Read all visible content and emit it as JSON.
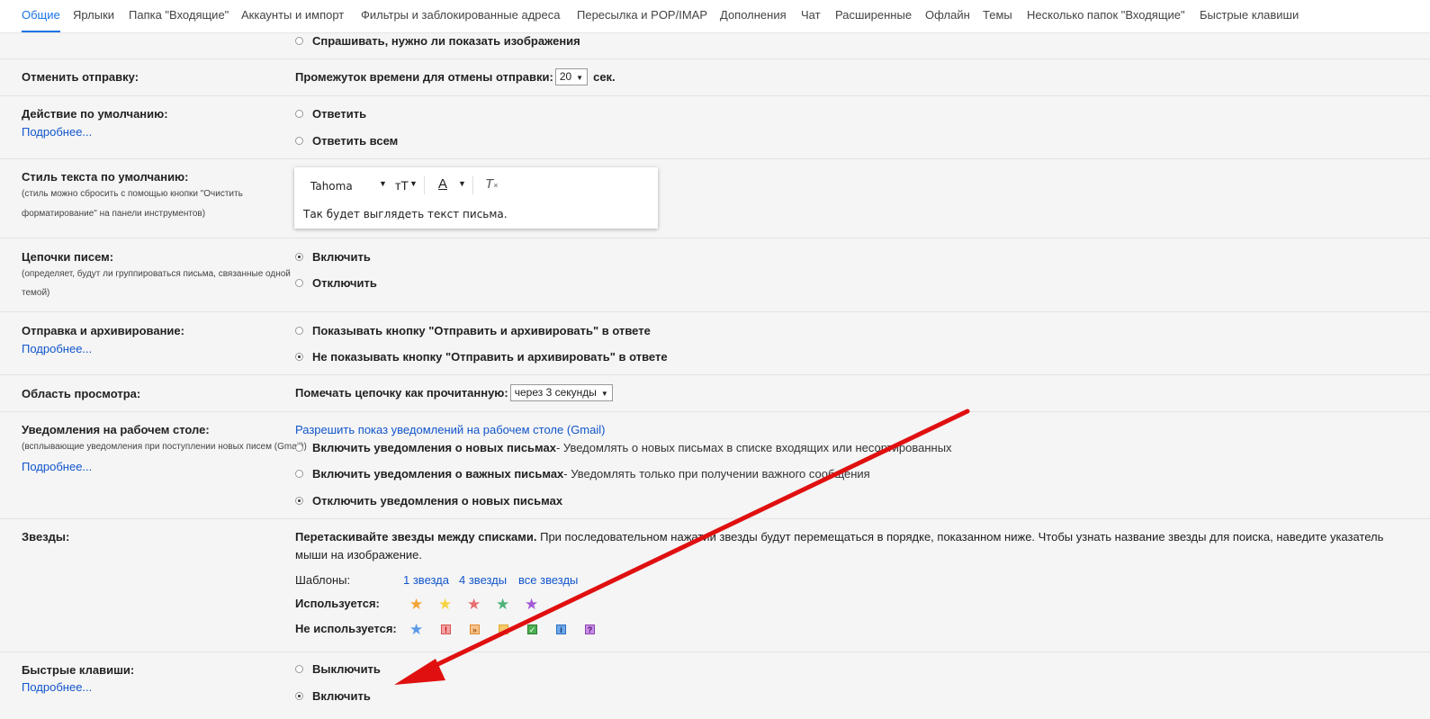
{
  "tabs": [
    "Общие",
    "Ярлыки",
    "Папка \"Входящие\"",
    "Аккаунты и импорт",
    "Фильтры и заблокированные адреса",
    "Пересылка и POP/IMAP",
    "Дополнения",
    "Чат",
    "Расширенные",
    "Офлайн",
    "Темы",
    "Несколько папок \"Входящие\"",
    "Быстрые клавиши"
  ],
  "active_tab": "Общие",
  "images": {
    "ask_option": "Спрашивать, нужно ли показать изображения"
  },
  "undo_send": {
    "label": "Отменить отправку:",
    "text": "Промежуток времени для отмены отправки:",
    "value": "20",
    "unit": "сек."
  },
  "default_reply": {
    "label": "Действие по умолчанию:",
    "more": "Подробнее...",
    "options": [
      "Ответить",
      "Ответить всем"
    ]
  },
  "text_style": {
    "label": "Стиль текста по умолчанию:",
    "hint_line1": "(стиль можно сбросить с помощью кнопки \"Очистить",
    "hint_line2": "форматирование\" на панели инструментов)",
    "font": "Tahoma",
    "preview": "Так будет выглядеть текст письма."
  },
  "threads": {
    "label": "Цепочки писем:",
    "hint_line1": "(определяет, будут ли группироваться письма, связанные одной",
    "hint_line2": "темой)",
    "options": [
      "Включить",
      "Отключить"
    ]
  },
  "send_archive": {
    "label": "Отправка и архивирование:",
    "more": "Подробнее...",
    "options": [
      "Показывать кнопку \"Отправить и архивировать\" в ответе",
      "Не показывать кнопку \"Отправить и архивировать\" в ответе"
    ]
  },
  "preview_pane": {
    "label": "Область просмотра:",
    "text": "Помечать цепочку как прочитанную:",
    "value": "через 3 секунды"
  },
  "desktop_notifications": {
    "label": "Уведомления на рабочем столе:",
    "hint": "(всплывающие уведомления при поступлении новых писем (Gmail))",
    "more": "Подробнее...",
    "allow_link": "Разрешить показ уведомлений на рабочем столе (Gmail)",
    "opt1_bold": "Включить уведомления о новых письмах",
    "opt1_desc": " - Уведомлять о новых письмах в списке входящих или несортированных",
    "opt2_bold": "Включить уведомления о важных письмах",
    "opt2_desc": " - Уведомлять только при получении важного сообщения",
    "opt3_bold": "Отключить уведомления о новых письмах"
  },
  "stars": {
    "label": "Звезды:",
    "desc_bold": "Перетаскивайте звезды между списками.",
    "desc_line1": " При последовательном нажатии звезды будут перемещаться в порядке, показанном ниже. Чтобы узнать название звезды для поиска, наведите указатель",
    "desc_line2": "мыши на изображение.",
    "presets_label": "Шаблоны:",
    "presets": [
      "1 звезда",
      "4 звезды",
      "все звезды"
    ],
    "in_use_label": "Используется:",
    "not_in_use_label": "Не используется:",
    "in_use_colors": [
      "#f2a536",
      "#f6d341",
      "#e56e6e",
      "#4fb37a",
      "#a259d4"
    ],
    "not_in_use_star_color": "#5b9be6",
    "not_in_use_icons": [
      "!",
      "»",
      "",
      "✓",
      "i",
      "?"
    ]
  },
  "shortcuts": {
    "label": "Быстрые клавиши:",
    "more": "Подробнее...",
    "options": [
      "Выключить",
      "Включить"
    ]
  },
  "annotation": {
    "arrow_color": "#e01010"
  }
}
